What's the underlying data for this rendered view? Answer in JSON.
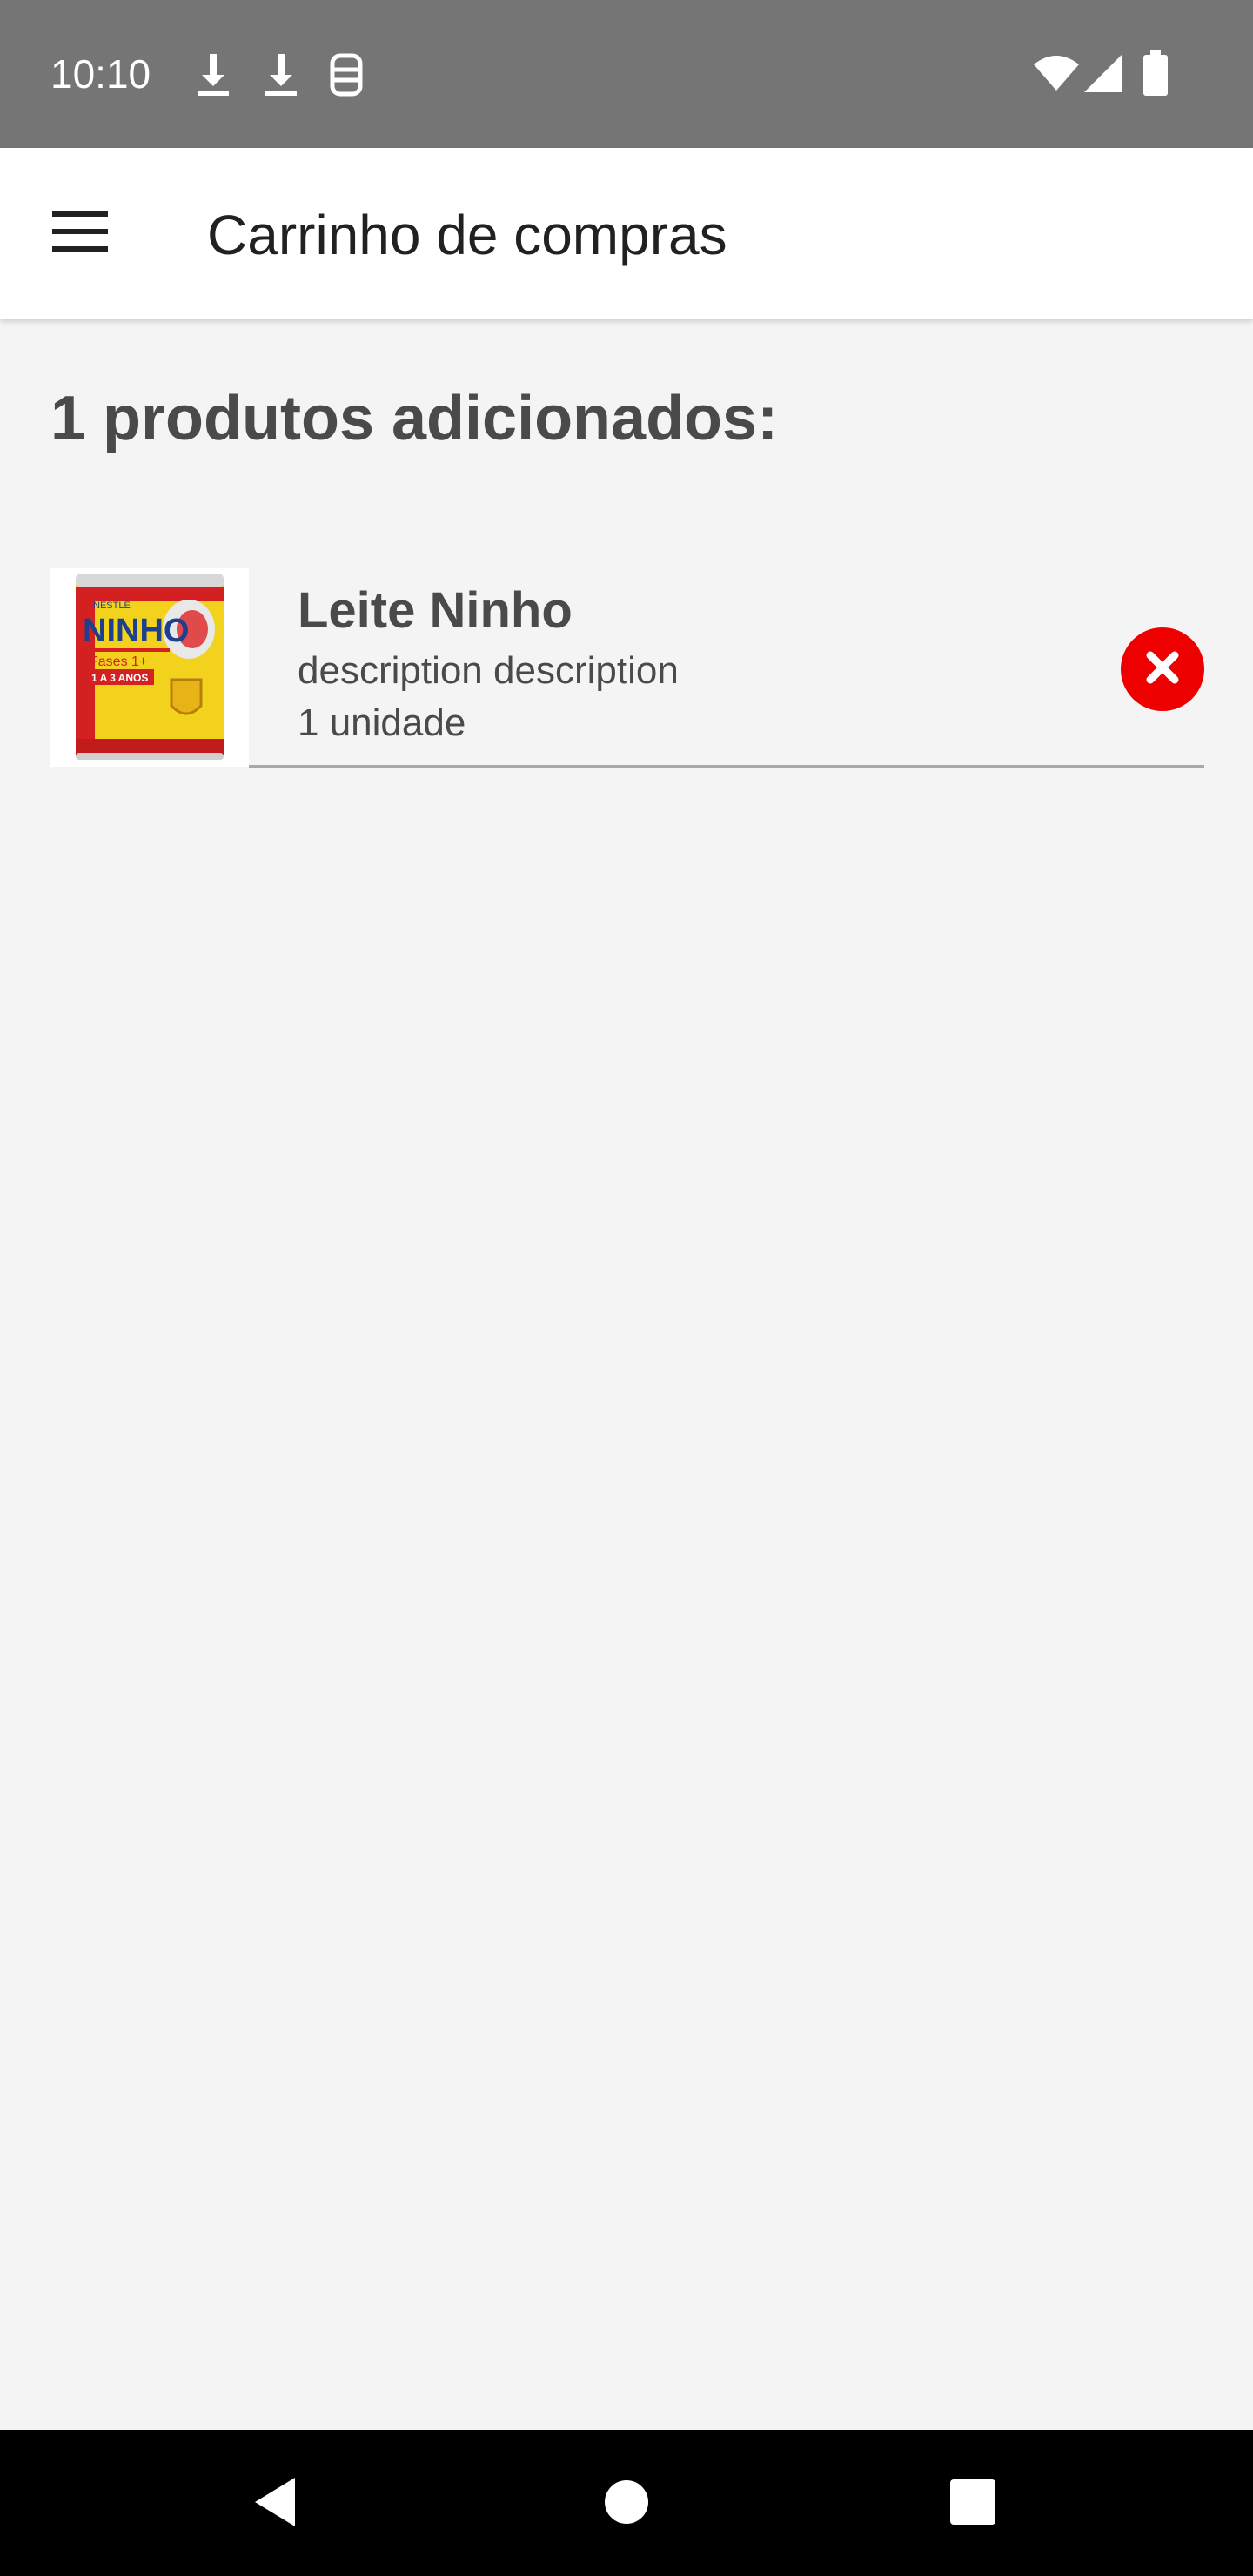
{
  "status_bar": {
    "time": "10:10",
    "left_icons": [
      "download-icon",
      "download-icon",
      "tray-icon"
    ],
    "right_icons": [
      "wifi-icon",
      "signal-icon",
      "battery-icon"
    ],
    "background": "#757575"
  },
  "app_bar": {
    "menu_icon": "hamburger-menu-icon",
    "title": "Carrinho de compras"
  },
  "cart": {
    "heading": "1 produtos adicionados:",
    "items": [
      {
        "name": "Leite Ninho",
        "description": "description description",
        "quantity": "1 unidade",
        "image_text": {
          "brand_small": "NESTLÉ",
          "brand": "NINHO",
          "line": "Fases 1+",
          "age": "1 A 3 ANOS"
        },
        "remove_icon": "close-icon",
        "remove_color": "#ee0000"
      }
    ]
  },
  "nav_bar": {
    "buttons": [
      "back-icon",
      "home-icon",
      "recents-icon"
    ]
  }
}
